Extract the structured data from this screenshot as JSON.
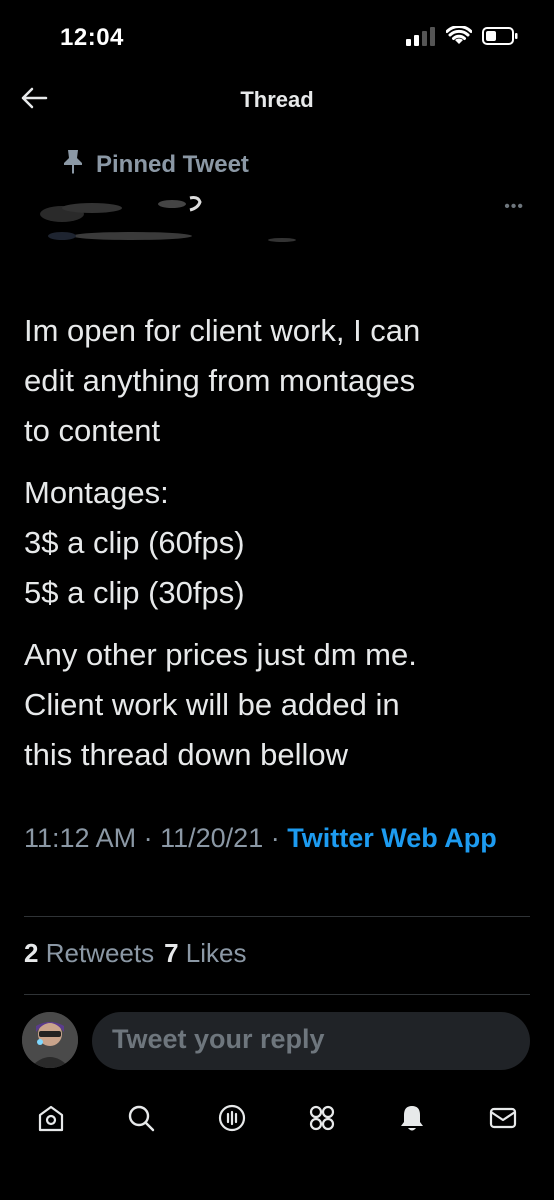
{
  "status_bar": {
    "time": "12:04"
  },
  "nav": {
    "title": "Thread"
  },
  "tweet": {
    "pinned_label": "Pinned Tweet",
    "paragraphs": [
      [
        "Im open for client work, I can",
        "edit anything from montages",
        "to content"
      ],
      [
        "Montages:",
        "3$ a clip (60fps)",
        "5$ a clip (30fps)"
      ],
      [
        "Any other prices just dm me.",
        "Client work will be added in",
        "this thread down bellow"
      ]
    ],
    "time": "11:12 AM",
    "date": "11/20/21",
    "separator": "·",
    "source": "Twitter Web App"
  },
  "stats": {
    "retweets_count": "2",
    "retweets_label": "Retweets",
    "likes_count": "7",
    "likes_label": "Likes"
  },
  "reply": {
    "placeholder": "Tweet your reply"
  },
  "tabs": [
    {
      "name": "home-icon"
    },
    {
      "name": "search-icon"
    },
    {
      "name": "spaces-icon"
    },
    {
      "name": "communities-icon"
    },
    {
      "name": "notifications-icon"
    },
    {
      "name": "messages-icon"
    }
  ],
  "colors": {
    "background": "#000000",
    "text": "#e7e9ea",
    "muted": "#8b98a5",
    "accent": "#1d9bf0"
  }
}
